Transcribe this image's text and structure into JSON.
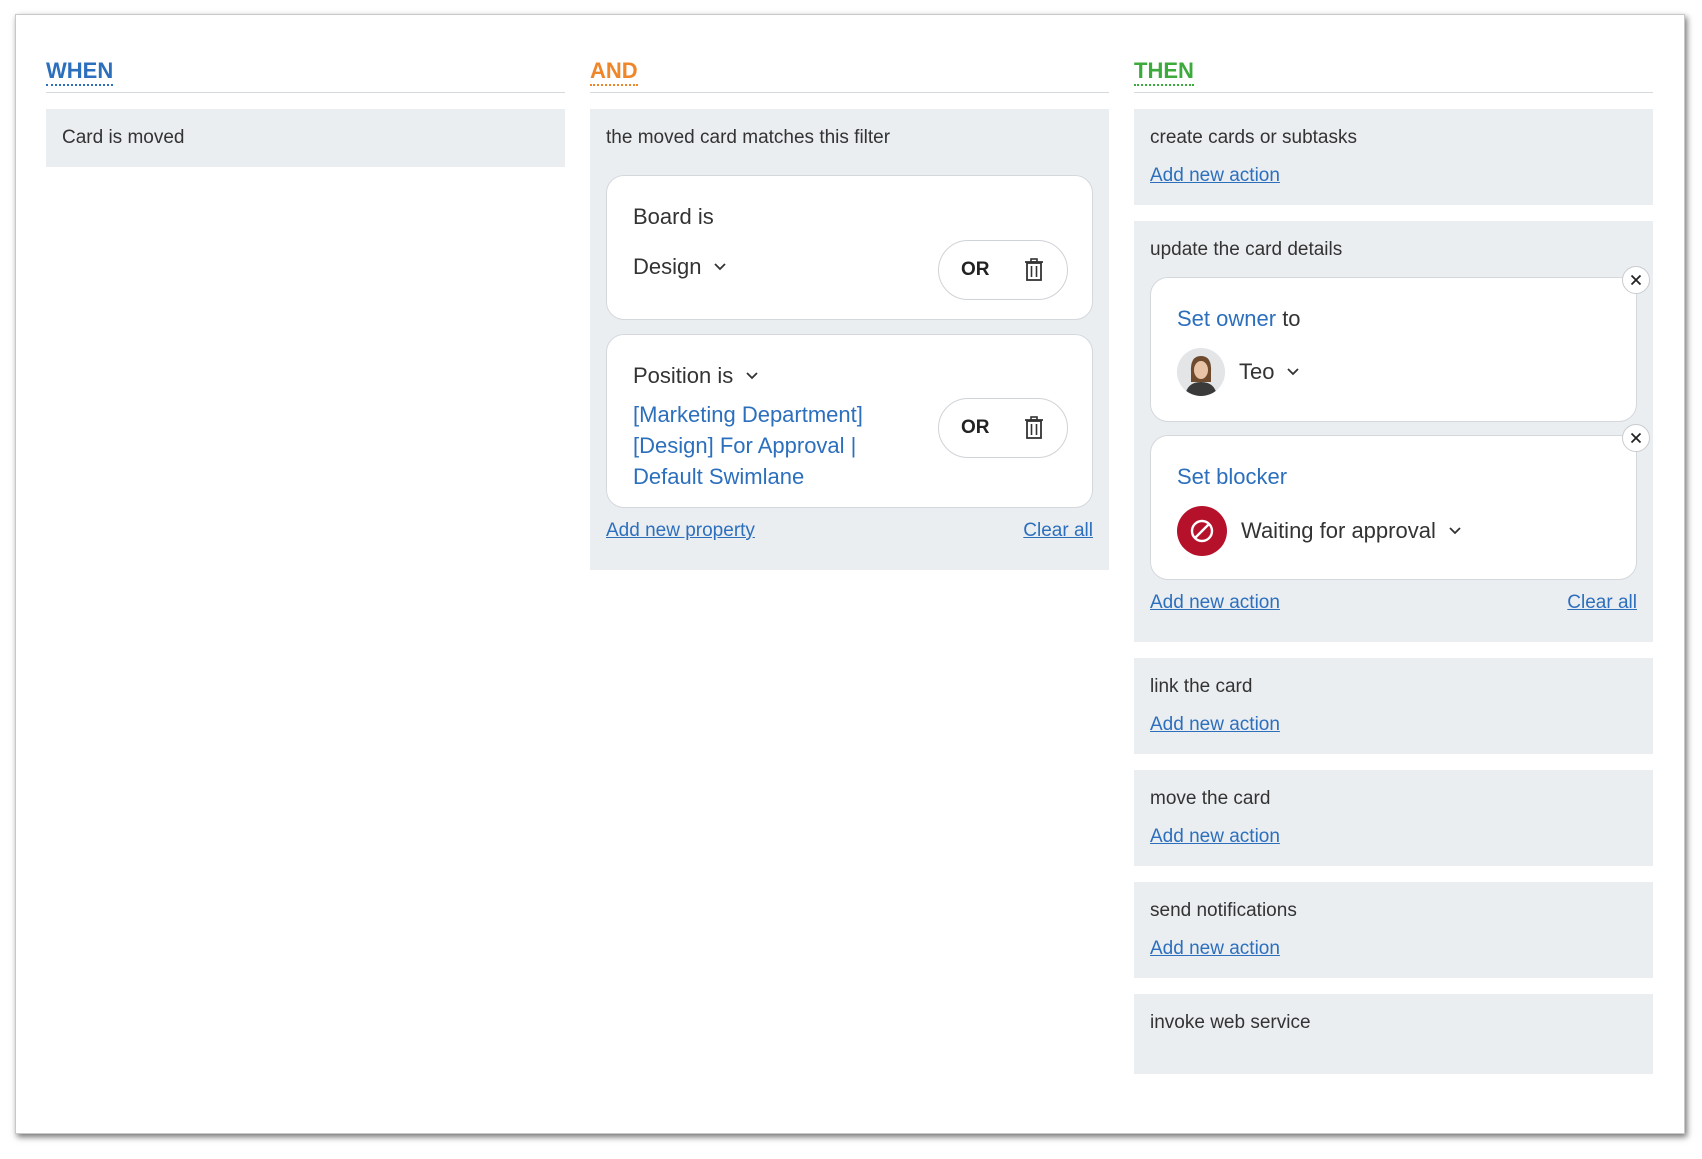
{
  "when": {
    "title": "WHEN",
    "title_color": "#2c6fbd",
    "trigger": "Card is moved"
  },
  "and": {
    "title": "AND",
    "title_color": "#f0862a",
    "section_title": "the moved card matches this filter",
    "board_filter": {
      "label": "Board is",
      "value": "Design",
      "or_label": "OR"
    },
    "position_filter": {
      "label": "Position is",
      "value": "[Marketing Department] [Design] For Approval | Default Swimlane",
      "or_label": "OR"
    },
    "add_property": "Add new property",
    "clear_all": "Clear all"
  },
  "then": {
    "title": "THEN",
    "title_color": "#3cab3c",
    "sections": {
      "create": {
        "title": "create cards or subtasks",
        "add": "Add new action"
      },
      "update": {
        "title": "update the card details",
        "owner_action": {
          "link": "Set owner",
          "suffix": "to",
          "value": "Teo"
        },
        "blocker_action": {
          "link": "Set blocker",
          "value": "Waiting for approval",
          "icon_color": "#b5112a"
        },
        "add": "Add new action",
        "clear_all": "Clear all"
      },
      "link": {
        "title": "link the card",
        "add": "Add new action"
      },
      "move": {
        "title": "move the card",
        "add": "Add new action"
      },
      "notify": {
        "title": "send notifications",
        "add": "Add new action"
      },
      "webservice": {
        "title": "invoke web service"
      }
    }
  }
}
